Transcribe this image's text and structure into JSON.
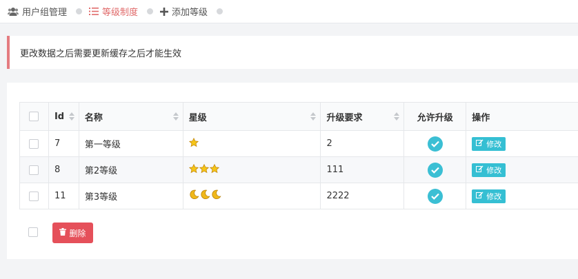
{
  "breadcrumb": {
    "items": [
      {
        "label": "用户组管理",
        "icon": "users-icon"
      },
      {
        "label": "等级制度",
        "icon": "list-icon",
        "active": true
      },
      {
        "label": "添加等级",
        "icon": "plus-icon"
      }
    ]
  },
  "notice": {
    "text": "更改数据之后需要更新缓存之后才能生效"
  },
  "table": {
    "columns": [
      "Id",
      "名称",
      "星级",
      "升级要求",
      "允许升级",
      "操作"
    ],
    "rows": [
      {
        "id": "7",
        "name": "第一等级",
        "stars": {
          "icon": "star-icon",
          "count": 1
        },
        "requirement": "2",
        "allow_upgrade": true,
        "action": "修改"
      },
      {
        "id": "8",
        "name": "第2等级",
        "stars": {
          "icon": "star-icon",
          "count": 3
        },
        "requirement": "111",
        "allow_upgrade": true,
        "action": "修改"
      },
      {
        "id": "11",
        "name": "第3等级",
        "stars": {
          "icon": "moon-icon",
          "count": 3
        },
        "requirement": "2222",
        "allow_upgrade": true,
        "action": "修改"
      }
    ]
  },
  "actions": {
    "delete_label": "删除"
  },
  "colors": {
    "accent": "#e06a6a",
    "info": "#35bfd3",
    "danger": "#e5505a",
    "notice_border": "#e47b80",
    "star": "#f5c518",
    "moon": "#f0b81a"
  }
}
